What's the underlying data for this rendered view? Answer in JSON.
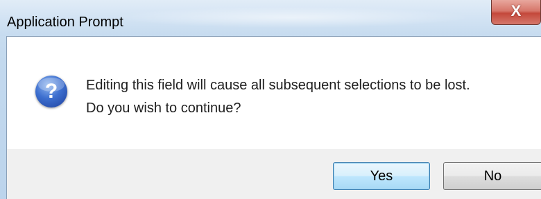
{
  "window": {
    "title": "Application Prompt",
    "close_label": "X"
  },
  "dialog": {
    "icon": "question-icon",
    "icon_glyph": "?",
    "message_line1": "Editing this field will cause all subsequent selections to be lost.",
    "message_line2": "Do you wish to continue?"
  },
  "buttons": {
    "yes_label": "Yes",
    "no_label": "No"
  },
  "colors": {
    "titlebar": "#c6dbef",
    "close_button": "#c4483b",
    "icon_blue": "#3d6fcf",
    "default_button_border": "#3c7fb1"
  }
}
